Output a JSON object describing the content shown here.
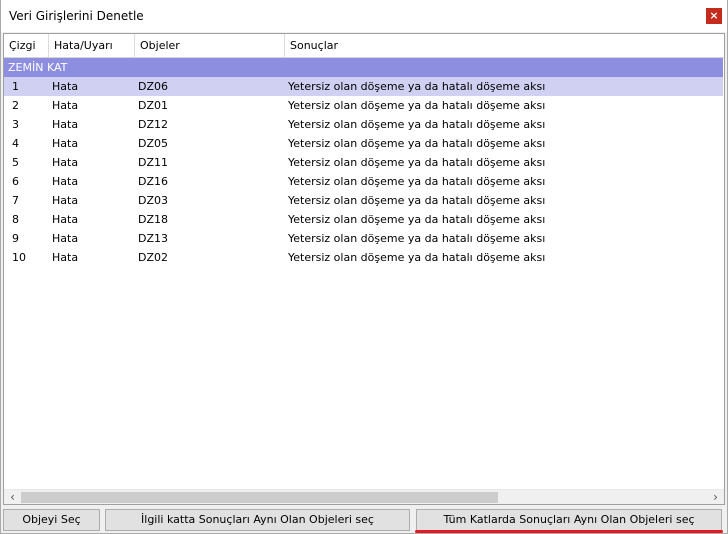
{
  "window": {
    "title": "Veri Girişlerini Denetle",
    "close_label": "×"
  },
  "grid": {
    "columns": [
      "Çizgi",
      "Hata/Uyarı",
      "Objeler",
      "Sonuçlar"
    ],
    "group_label": "ZEMİN KAT",
    "rows": [
      {
        "line": "1",
        "type": "Hata",
        "object": "DZ06",
        "result": "Yetersiz olan döşeme ya da hatalı döşeme aksı"
      },
      {
        "line": "2",
        "type": "Hata",
        "object": "DZ01",
        "result": "Yetersiz olan döşeme ya da hatalı döşeme aksı"
      },
      {
        "line": "3",
        "type": "Hata",
        "object": "DZ12",
        "result": "Yetersiz olan döşeme ya da hatalı döşeme aksı"
      },
      {
        "line": "4",
        "type": "Hata",
        "object": "DZ05",
        "result": "Yetersiz olan döşeme ya da hatalı döşeme aksı"
      },
      {
        "line": "5",
        "type": "Hata",
        "object": "DZ11",
        "result": "Yetersiz olan döşeme ya da hatalı döşeme aksı"
      },
      {
        "line": "6",
        "type": "Hata",
        "object": "DZ16",
        "result": "Yetersiz olan döşeme ya da hatalı döşeme aksı"
      },
      {
        "line": "7",
        "type": "Hata",
        "object": "DZ03",
        "result": "Yetersiz olan döşeme ya da hatalı döşeme aksı"
      },
      {
        "line": "8",
        "type": "Hata",
        "object": "DZ18",
        "result": "Yetersiz olan döşeme ya da hatalı döşeme aksı"
      },
      {
        "line": "9",
        "type": "Hata",
        "object": "DZ13",
        "result": "Yetersiz olan döşeme ya da hatalı döşeme aksı"
      },
      {
        "line": "10",
        "type": "Hata",
        "object": "DZ02",
        "result": "Yetersiz olan döşeme ya da hatalı döşeme aksı"
      }
    ],
    "selected_row_index": 0
  },
  "scrollbar": {
    "left_arrow": "‹",
    "right_arrow": "›"
  },
  "buttons": {
    "select_object": "Objeyi Seç",
    "select_same_floor": "İlgili katta Sonuçları Aynı Olan Objeleri seç",
    "select_all_floors": "Tüm Katlarda Sonuçları Aynı Olan Objeleri seç"
  },
  "colors": {
    "group_bg": "#8e8ee0",
    "selected_bg": "#d0d0f3",
    "close_bg": "#c42b1c",
    "highlight_underline": "#e01b24"
  }
}
